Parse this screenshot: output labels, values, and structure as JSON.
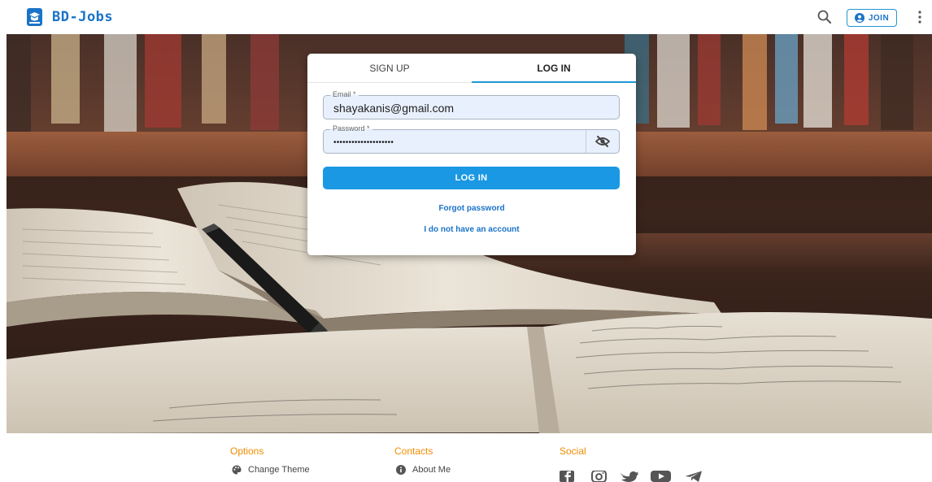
{
  "header": {
    "app_title": "BD-Jobs",
    "join_label": "JOIN",
    "icons": [
      "logo-icon",
      "search-icon",
      "account-circle-icon",
      "more-vert-icon"
    ]
  },
  "auth_card": {
    "tabs": [
      {
        "label": "SIGN UP",
        "active": false
      },
      {
        "label": "LOG IN",
        "active": true
      }
    ],
    "email": {
      "label": "Email *",
      "value": "shayakanis@gmail.com"
    },
    "password": {
      "label": "Password *",
      "value": "••••••••••••••••••••"
    },
    "login_button": "LOG IN",
    "forgot_password": "Forgot password",
    "no_account": "I do not have an account"
  },
  "footer": {
    "options": {
      "title": "Options",
      "items": [
        "Change Theme"
      ]
    },
    "contacts": {
      "title": "Contacts",
      "items": [
        "About Me"
      ]
    },
    "social": {
      "title": "Social",
      "icons": [
        "facebook-icon",
        "instagram-icon",
        "twitter-icon",
        "youtube-icon",
        "telegram-icon"
      ]
    }
  },
  "colors": {
    "brand": "#1a73c8",
    "accent": "#2196d3",
    "button": "#1a98e3",
    "footer_title": "#f08c00",
    "field_bg": "#e8f0fe"
  }
}
